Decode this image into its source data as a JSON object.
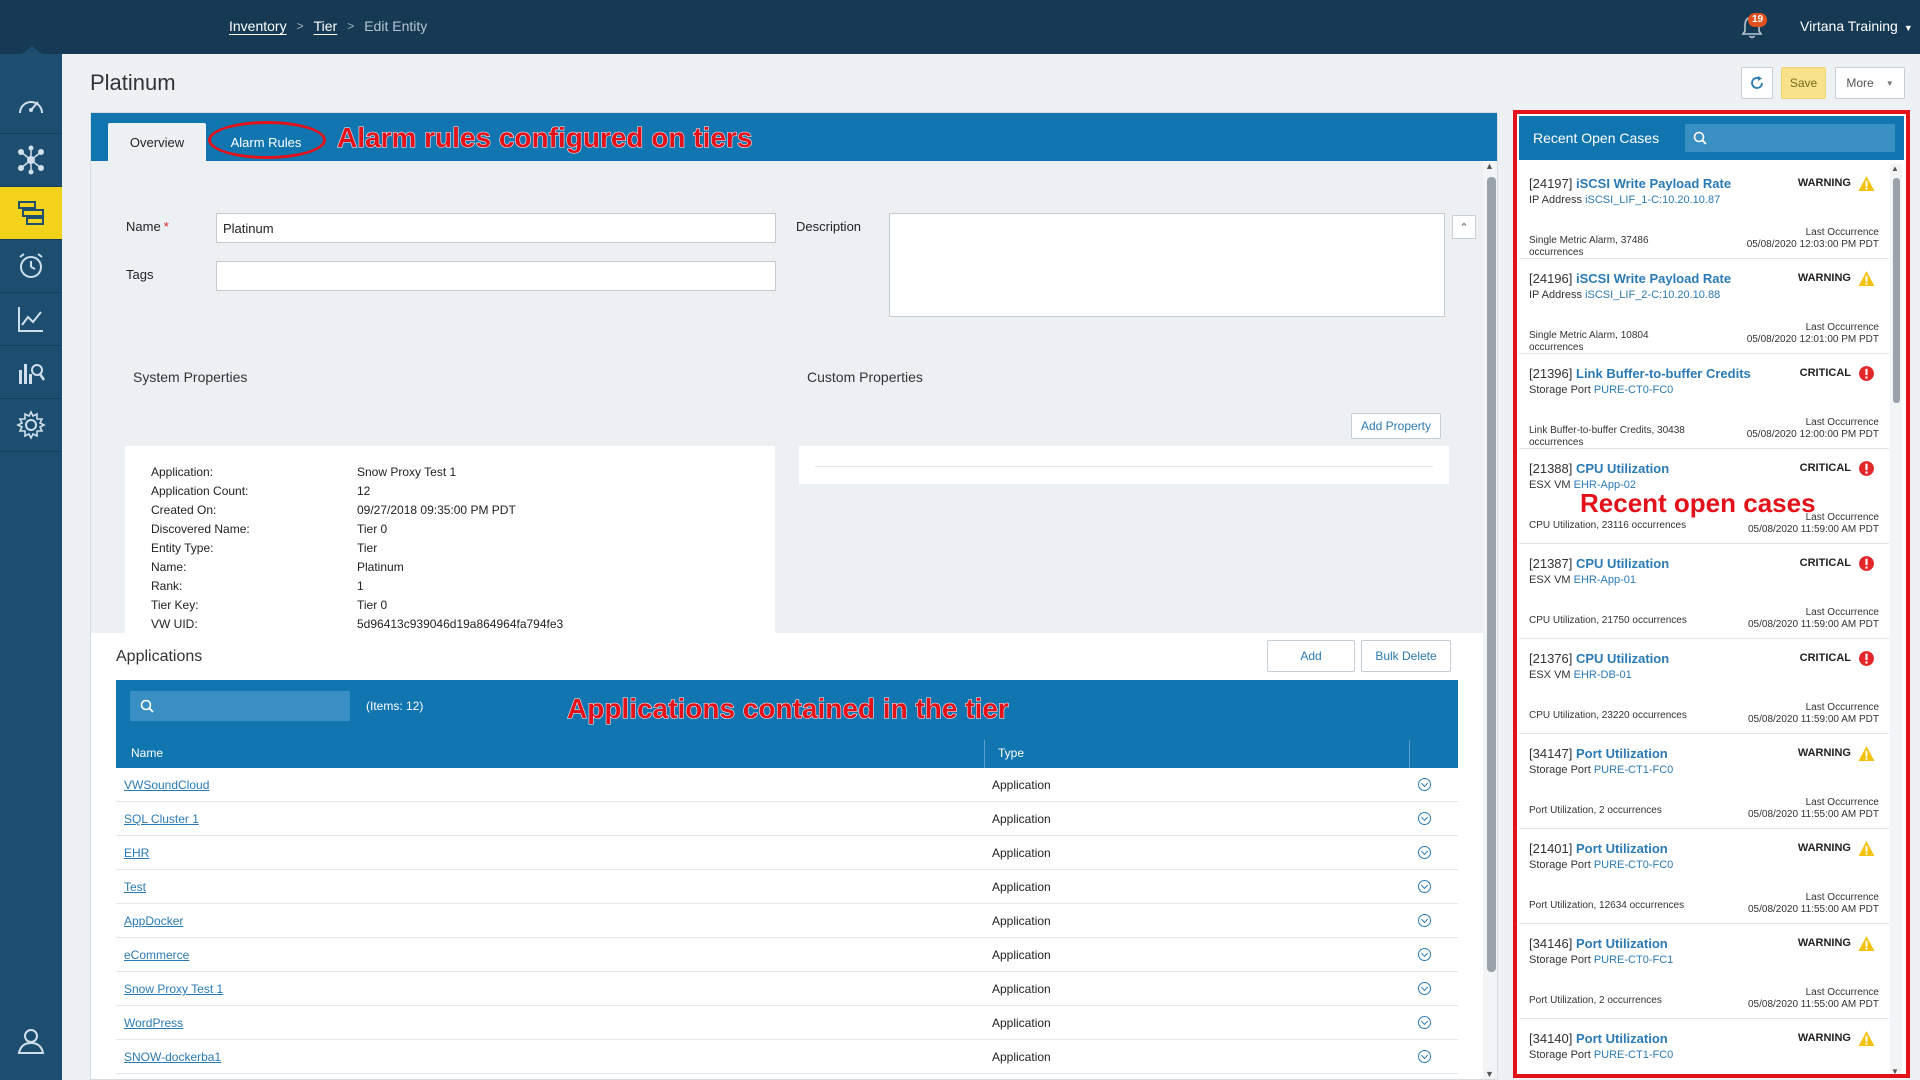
{
  "header": {
    "breadcrumb": [
      {
        "label": "Inventory"
      },
      {
        "label": "Tier"
      },
      {
        "label": "Edit Entity"
      }
    ],
    "notification_count": "19",
    "user": "Virtana Training"
  },
  "page": {
    "title": "Platinum",
    "save_label": "Save",
    "more_label": "More"
  },
  "tabs": {
    "overview": "Overview",
    "alarm_rules": "Alarm Rules"
  },
  "annotations": {
    "alarm": "Alarm rules configured on tiers",
    "apps": "Applications contained in the tier",
    "cases": "Recent open cases"
  },
  "form": {
    "name_label": "Name",
    "name_required": "*",
    "name_value": "Platinum",
    "tags_label": "Tags",
    "tags_value": "",
    "description_label": "Description"
  },
  "system_properties": {
    "title": "System Properties",
    "rows": [
      {
        "key": "Application:",
        "value": "Snow Proxy Test 1"
      },
      {
        "key": "Application Count:",
        "value": "12"
      },
      {
        "key": "Created On:",
        "value": "09/27/2018 09:35:00 PM PDT"
      },
      {
        "key": "Discovered Name:",
        "value": "Tier 0"
      },
      {
        "key": "Entity Type:",
        "value": "Tier"
      },
      {
        "key": "Name:",
        "value": "Platinum"
      },
      {
        "key": "Rank:",
        "value": "1"
      },
      {
        "key": "Tier Key:",
        "value": "Tier 0"
      },
      {
        "key": "VW UID:",
        "value": "5d96413c939046d19a864964fa794fe3"
      }
    ]
  },
  "custom_properties": {
    "title": "Custom Properties",
    "add_label": "Add Property"
  },
  "applications": {
    "title": "Applications",
    "add_label": "Add",
    "bulk_delete_label": "Bulk Delete",
    "items_count": "(Items: 12)",
    "columns": {
      "name": "Name",
      "type": "Type"
    },
    "rows": [
      {
        "name": "VWSoundCloud",
        "type": "Application"
      },
      {
        "name": "SQL Cluster 1",
        "type": "Application"
      },
      {
        "name": "EHR",
        "type": "Application"
      },
      {
        "name": "Test",
        "type": "Application"
      },
      {
        "name": "AppDocker",
        "type": "Application"
      },
      {
        "name": "eCommerce",
        "type": "Application"
      },
      {
        "name": "Snow Proxy Test 1",
        "type": "Application"
      },
      {
        "name": "WordPress",
        "type": "Application"
      },
      {
        "name": "SNOW-dockerba1",
        "type": "Application"
      }
    ]
  },
  "cases": {
    "title": "Recent Open Cases",
    "last_occurrence_label": "Last Occurrence",
    "items": [
      {
        "id": "[24197]",
        "name": "iSCSI Write Payload Rate",
        "entity_type": "IP Address",
        "entity": "iSCSI_LIF_1-C:10.20.10.87",
        "severity": "WARNING",
        "occurrences": "Single Metric Alarm, 37486 occurrences",
        "last": "05/08/2020 12:03:00 PM PDT"
      },
      {
        "id": "[24196]",
        "name": "iSCSI Write Payload Rate",
        "entity_type": "IP Address",
        "entity": "iSCSI_LIF_2-C:10.20.10.88",
        "severity": "WARNING",
        "occurrences": "Single Metric Alarm, 10804 occurrences",
        "last": "05/08/2020 12:01:00 PM PDT"
      },
      {
        "id": "[21396]",
        "name": "Link Buffer-to-buffer Credits",
        "entity_type": "Storage Port",
        "entity": "PURE-CT0-FC0",
        "severity": "CRITICAL",
        "occurrences": "Link Buffer-to-buffer Credits, 30438 occurrences",
        "last": "05/08/2020 12:00:00 PM PDT"
      },
      {
        "id": "[21388]",
        "name": "CPU Utilization",
        "entity_type": "ESX VM",
        "entity": "EHR-App-02",
        "severity": "CRITICAL",
        "occurrences": "CPU Utilization, 23116 occurrences",
        "last": "05/08/2020 11:59:00 AM PDT"
      },
      {
        "id": "[21387]",
        "name": "CPU Utilization",
        "entity_type": "ESX VM",
        "entity": "EHR-App-01",
        "severity": "CRITICAL",
        "occurrences": "CPU Utilization, 21750 occurrences",
        "last": "05/08/2020 11:59:00 AM PDT"
      },
      {
        "id": "[21376]",
        "name": "CPU Utilization",
        "entity_type": "ESX VM",
        "entity": "EHR-DB-01",
        "severity": "CRITICAL",
        "occurrences": "CPU Utilization, 23220 occurrences",
        "last": "05/08/2020 11:59:00 AM PDT"
      },
      {
        "id": "[34147]",
        "name": "Port Utilization",
        "entity_type": "Storage Port",
        "entity": "PURE-CT1-FC0",
        "severity": "WARNING",
        "occurrences": "Port Utilization, 2 occurrences",
        "last": "05/08/2020 11:55:00 AM PDT"
      },
      {
        "id": "[21401]",
        "name": "Port Utilization",
        "entity_type": "Storage Port",
        "entity": "PURE-CT0-FC0",
        "severity": "WARNING",
        "occurrences": "Port Utilization, 12634 occurrences",
        "last": "05/08/2020 11:55:00 AM PDT"
      },
      {
        "id": "[34146]",
        "name": "Port Utilization",
        "entity_type": "Storage Port",
        "entity": "PURE-CT0-FC1",
        "severity": "WARNING",
        "occurrences": "Port Utilization, 2 occurrences",
        "last": "05/08/2020 11:55:00 AM PDT"
      },
      {
        "id": "[34140]",
        "name": "Port Utilization",
        "entity_type": "Storage Port",
        "entity": "PURE-CT1-FC0",
        "severity": "WARNING",
        "occurrences": "",
        "last": ""
      }
    ]
  },
  "rail": {
    "items": [
      {
        "icon": "dashboard-gauge-icon",
        "active": false
      },
      {
        "icon": "topology-network-icon",
        "active": false
      },
      {
        "icon": "inventory-list-icon",
        "active": true
      },
      {
        "icon": "alarm-clock-icon",
        "active": false
      },
      {
        "icon": "analytics-chart-icon",
        "active": false
      },
      {
        "icon": "reports-search-icon",
        "active": false
      },
      {
        "icon": "settings-gear-icon",
        "active": false
      }
    ],
    "user_icon": "user-profile-icon"
  },
  "colors": {
    "header_bg": "#163a54",
    "rail_bg": "#1d4e6f",
    "rail_active": "#f3d21b",
    "accent_blue": "#1175b0",
    "link": "#2a7ab5",
    "annotation_red": "#e3121a",
    "warning": "#f2c20f",
    "critical": "#e3262a"
  }
}
